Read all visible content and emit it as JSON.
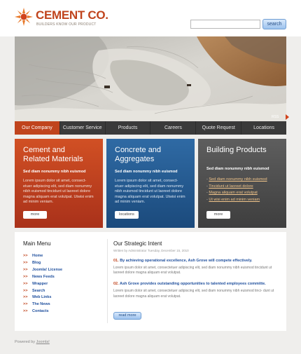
{
  "header": {
    "logo_title": "CEMENT CO.",
    "logo_tagline": "BUILDERS KNOW OUR PRODUCT",
    "search_placeholder": "",
    "search_button": "search"
  },
  "hero": {
    "rss_label": "RSS",
    "colors": {
      "accent": "#c0441d"
    }
  },
  "nav": {
    "items": [
      {
        "label": "Our Company",
        "active": true
      },
      {
        "label": "Customer Service",
        "active": false
      },
      {
        "label": "Products",
        "active": false
      },
      {
        "label": "Careers",
        "active": false
      },
      {
        "label": "Quote Request",
        "active": false
      },
      {
        "label": "Locations",
        "active": false
      }
    ]
  },
  "columns": [
    {
      "title_line1": "Cement and",
      "title_line2": "Related Materials",
      "subtitle": "Sed diam nonummy nibh euismod",
      "body": "Lorem ipsum dolor sit amet, consect- etuer adipiscing elit, sed diam nonummy nibh euismod tincidunt ut laoreet dolore magna aliquam erat volutpat. Utwisi enim ad minim veniam.",
      "button": "more",
      "color": "#c0441d"
    },
    {
      "title_line1": "Concrete and",
      "title_line2": "Aggregates",
      "subtitle": "Sed diam nonummy nibh euismod",
      "body": "Lorem ipsum dolor sit amet, consect- etuer adipiscing elit, sed diam nonummy nibh euismod tincidunt ut laoreet dolore magna aliquam erat volutpat. Utwisi enim ad minim veniam.",
      "button": "locations",
      "color": "#245a94"
    },
    {
      "title_line1": "Building Products",
      "subtitle": "Sed diam nonummy nibh euismod",
      "links": [
        "Sed diam nonummy nibh euismod",
        "Tincidunt ut laoreet dolore",
        "Magna aliquam erat volutpat",
        "Ut wisi enim ad minim veniam"
      ],
      "button": "more",
      "color": "#4a4a4a"
    }
  ],
  "menu": {
    "title": "Main Menu",
    "items": [
      "Home",
      "Blog",
      "Joomla! License",
      "News Feeds",
      "Wrapper",
      "Search",
      "Web Links",
      "The News",
      "Contacts"
    ]
  },
  "article": {
    "title": "Our Strategic Intent",
    "meta": "Written by Administrator  Tuesday, December 15, 2010",
    "p1_num": "01.",
    "p1_head": "By achieving operational excellence, Ash Grove will compete effectively.",
    "p1_text": "Lorem ipsum dolor sit amet, consectetuer adipiscing elit, sed diam nonummy nibh euismod tincidunt ut laoreet dolore magna aliquam erat volutpat.",
    "p2_num": "02.",
    "p2_head": "Ash Grove provides outstanding opportunities to talented employees committe.",
    "p2_text": "Lorem ipsum dolor sit amet, consectetuer adipiscing elit, sed diam nonummy nibh euismod tinci- dunt ut laoreet dolore magna aliquam erat volutpat.",
    "button": "read more"
  },
  "footer": {
    "prefix": "Powered by",
    "link": "Joomla!"
  }
}
